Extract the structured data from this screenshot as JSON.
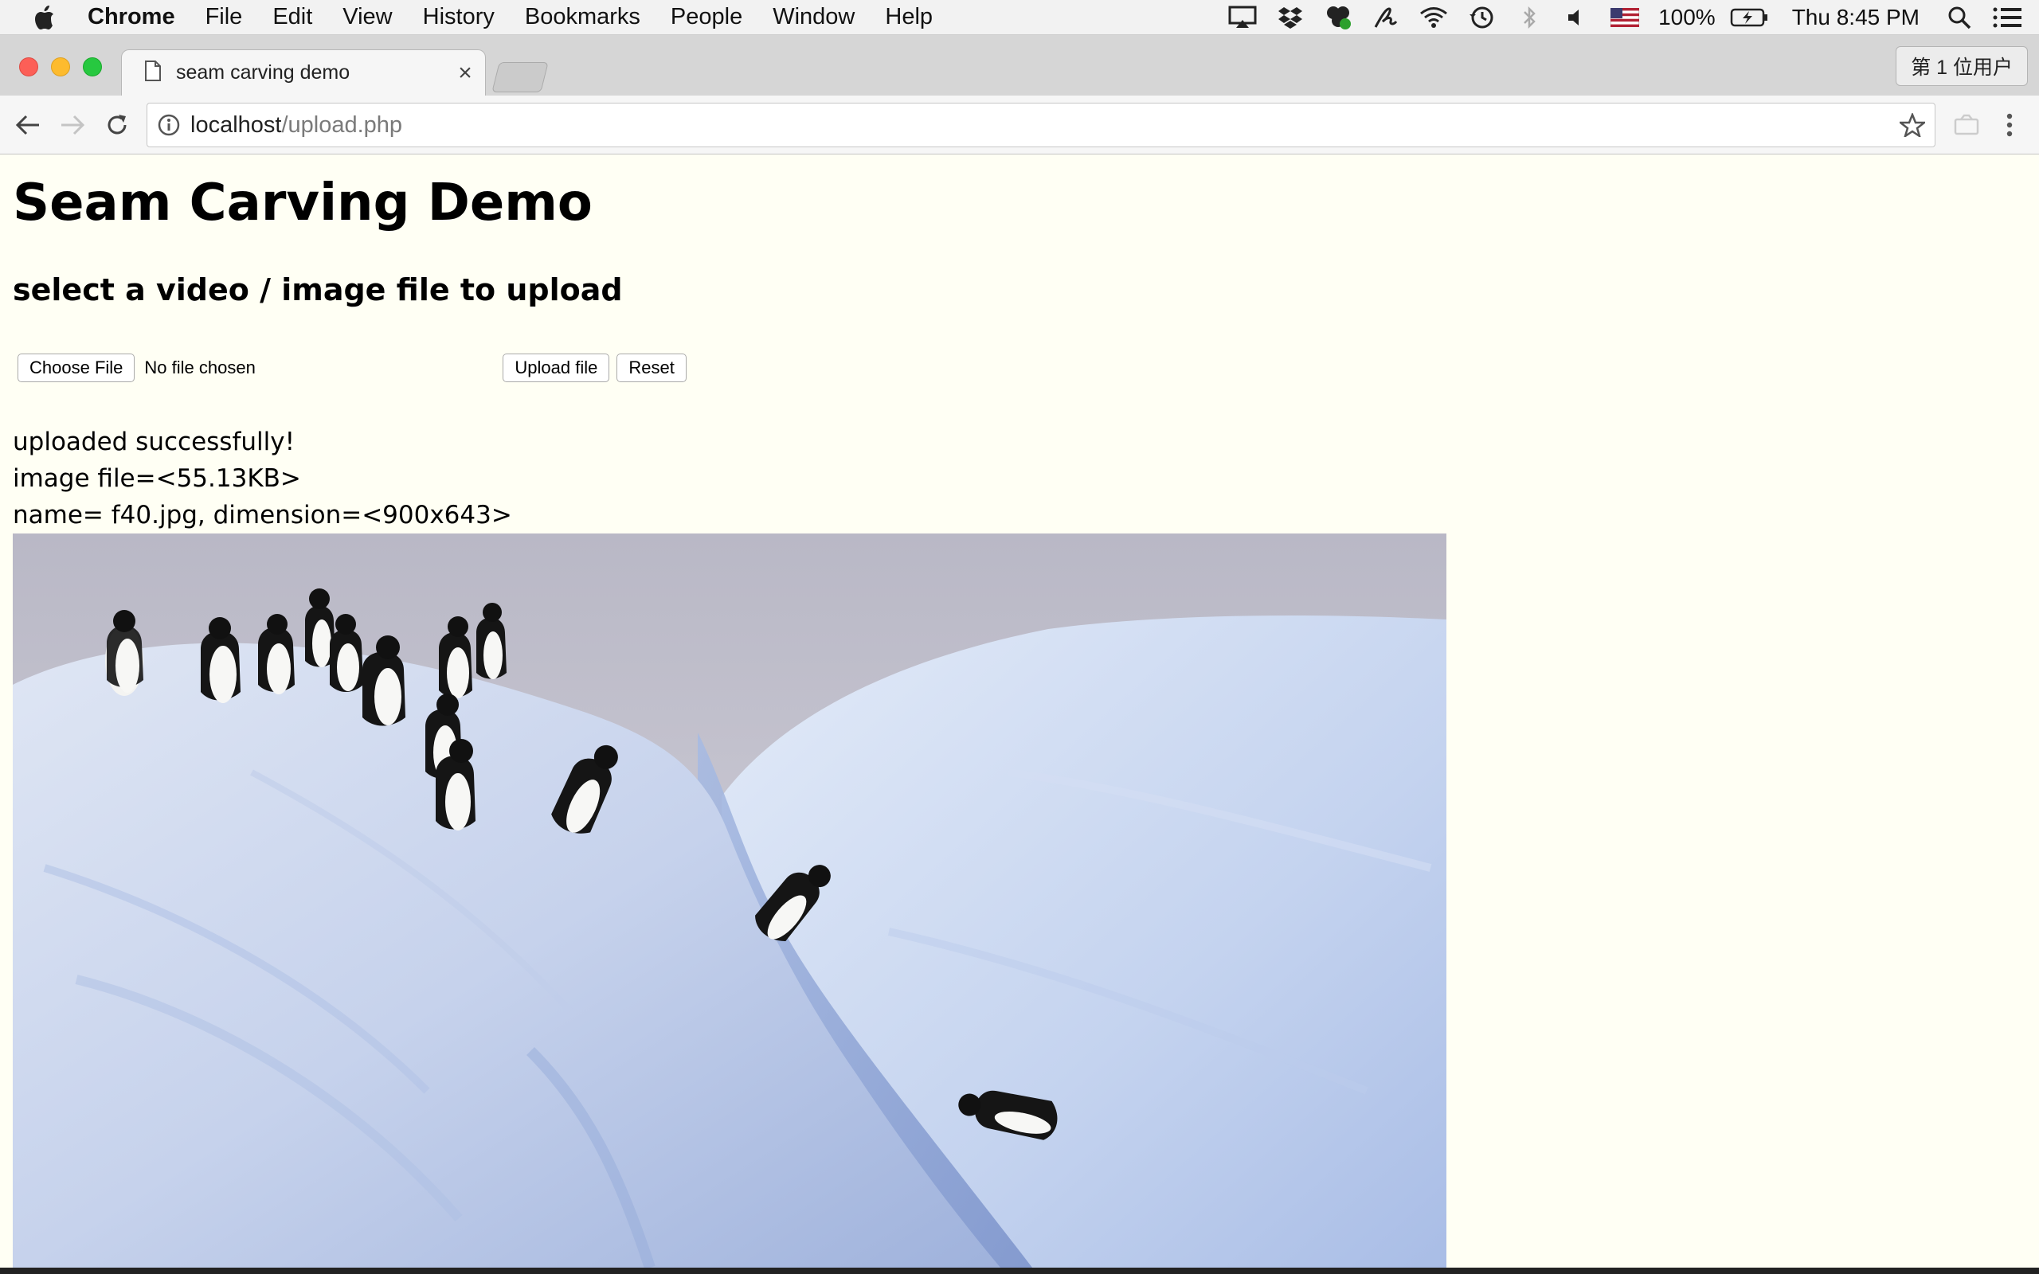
{
  "menubar": {
    "app_name": "Chrome",
    "items": [
      "File",
      "Edit",
      "View",
      "History",
      "Bookmarks",
      "People",
      "Window",
      "Help"
    ],
    "battery": "100%",
    "clock": "Thu 8:45 PM"
  },
  "browser": {
    "tab_title": "seam carving demo",
    "user_button": "第 1 位用户",
    "url_host": "localhost",
    "url_path": "/upload.php"
  },
  "page": {
    "title": "Seam Carving Demo",
    "subtitle": "select a video / image file to upload",
    "choose_file_label": "Choose File",
    "file_status": "No file chosen",
    "upload_label": "Upload file",
    "reset_label": "Reset",
    "result_lines": [
      "uploaded successfully!",
      "image file=<55.13KB>",
      "name= f40.jpg, dimension=<900x643>"
    ]
  },
  "colors": {
    "page_background": "#fffff4",
    "menubar_background": "#f2f2f2",
    "tabstrip_background": "#d6d6d6"
  }
}
